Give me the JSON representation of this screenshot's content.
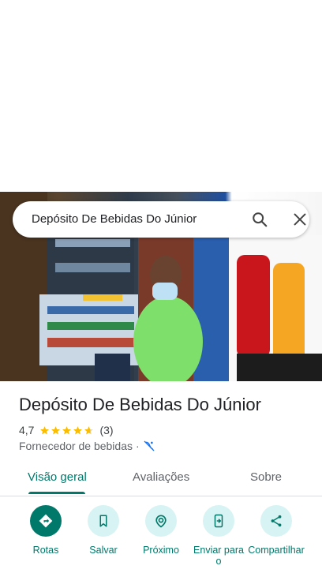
{
  "search": {
    "query": "Depósito De Bebidas Do Júnior"
  },
  "place": {
    "name": "Depósito De Bebidas Do Júnior",
    "rating": "4,7",
    "rating_value": 4.7,
    "review_count": "(3)",
    "category": "Fornecedor de bebidas",
    "separator": "·",
    "status_icon": "no-delivery-icon"
  },
  "tabs": [
    {
      "label": "Visão geral",
      "active": true
    },
    {
      "label": "Avaliações",
      "active": false
    },
    {
      "label": "Sobre",
      "active": false
    }
  ],
  "actions": [
    {
      "label": "Rotas",
      "icon": "directions-icon"
    },
    {
      "label": "Salvar",
      "icon": "bookmark-icon"
    },
    {
      "label": "Próximo",
      "icon": "nearby-icon"
    },
    {
      "label": "Enviar para o",
      "icon": "send-to-phone-icon"
    },
    {
      "label": "Compartilhar",
      "icon": "share-icon"
    }
  ],
  "colors": {
    "accent": "#00796b",
    "accent_light": "#d7f3f3",
    "star": "#fbbc04"
  }
}
